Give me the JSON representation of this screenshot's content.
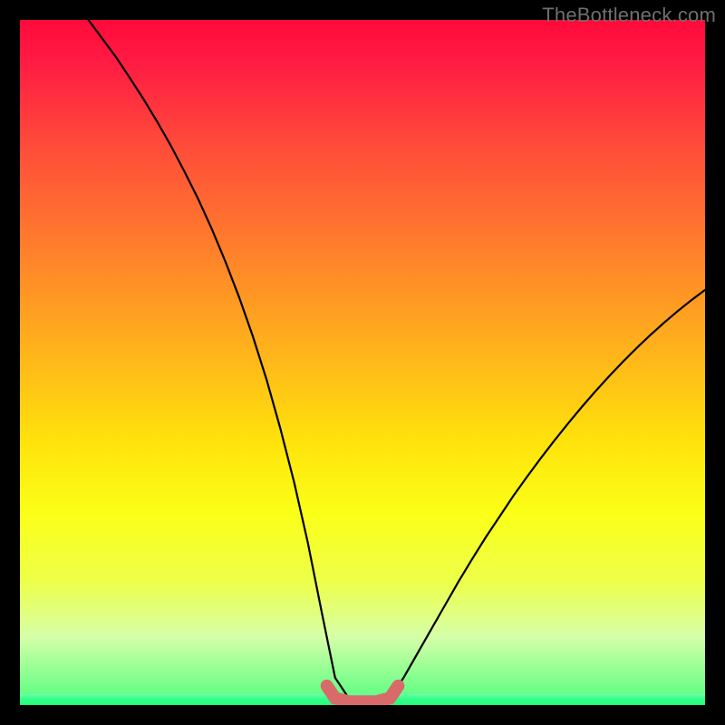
{
  "watermark": {
    "text": "TheBottleneck.com"
  },
  "colors": {
    "curve_stroke": "#000000",
    "marker_stroke": "#d96a6a",
    "gradient_top": "#ff0a3a",
    "gradient_bottom": "#23ff77"
  },
  "chart_data": {
    "type": "line",
    "title": "",
    "xlabel": "",
    "ylabel": "",
    "xlim": [
      0,
      100
    ],
    "ylim": [
      0,
      100
    ],
    "grid": false,
    "series": [
      {
        "name": "curve",
        "x": [
          10,
          12,
          14,
          16,
          18,
          20,
          22,
          24,
          26,
          28,
          30,
          32,
          34,
          36,
          38,
          40,
          42,
          44,
          46,
          48,
          50,
          52,
          54,
          56,
          58,
          60,
          62,
          64,
          66,
          68,
          70,
          72,
          74,
          76,
          78,
          80,
          82,
          84,
          86,
          88,
          90,
          92,
          94,
          96,
          98,
          100
        ],
        "y": [
          100,
          97.3,
          94.6,
          91.6,
          88.5,
          85.2,
          81.7,
          77.9,
          73.9,
          69.5,
          64.7,
          59.5,
          53.8,
          47.5,
          40.4,
          32.6,
          23.8,
          13.8,
          4,
          1,
          0.5,
          0.5,
          1,
          4,
          7.5,
          11,
          14.5,
          18,
          21.3,
          24.5,
          27.5,
          30.5,
          33.3,
          36,
          38.6,
          41.1,
          43.5,
          45.8,
          48,
          50.1,
          52.1,
          54,
          55.8,
          57.5,
          59.1,
          60.6
        ]
      },
      {
        "name": "marker",
        "x": [
          44.8,
          46,
          48,
          50,
          52,
          54,
          55.2
        ],
        "y": [
          2.8,
          1,
          0.5,
          0.5,
          0.5,
          1,
          2.8
        ]
      }
    ],
    "annotations": []
  }
}
